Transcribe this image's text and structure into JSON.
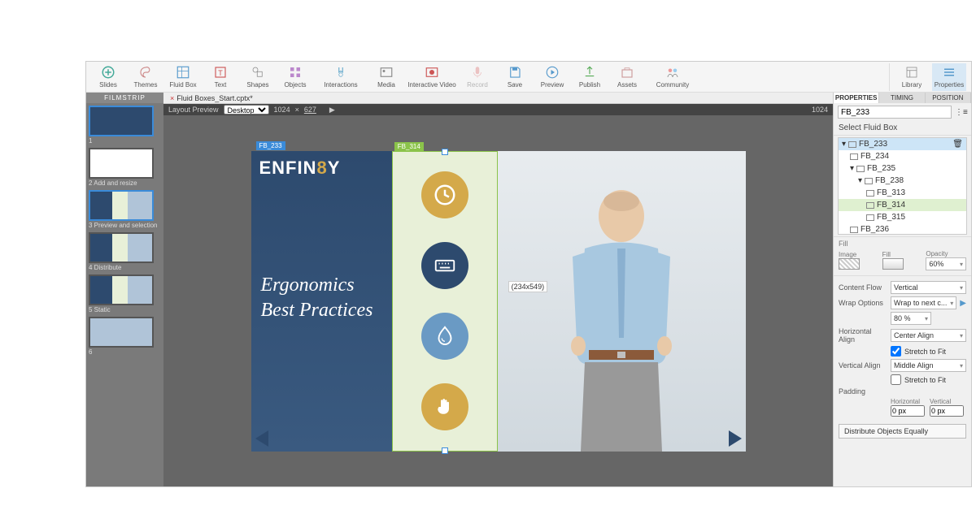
{
  "toolbar": {
    "items": [
      "Slides",
      "Themes",
      "Fluid Box",
      "Text",
      "Shapes",
      "Objects",
      "Interactions",
      "Media",
      "Interactive Video",
      "Record",
      "Save",
      "Preview",
      "Publish",
      "Assets",
      "Community"
    ],
    "right": [
      "Library",
      "Properties"
    ]
  },
  "filmstrip": {
    "header": "FILMSTRIP",
    "thumbs": [
      {
        "cap": "1"
      },
      {
        "cap": "2 Add and resize"
      },
      {
        "cap": "3 Preview and selection"
      },
      {
        "cap": "4 Distribute"
      },
      {
        "cap": "5 Static"
      },
      {
        "cap": "6"
      }
    ]
  },
  "doc": {
    "tab": "Fluid Boxes_Start.cptx*",
    "layoutPreview": "Layout Preview",
    "device": "Desktop",
    "w": "1024",
    "h": "627",
    "rulerMark": "1024"
  },
  "slide": {
    "fb233": "FB_233",
    "fb314": "FB_314",
    "logo_pre": "ENFIN",
    "logo_num": "8",
    "logo_post": "Y",
    "title": "Ergonomics Best Practices",
    "dim": "(234x549)"
  },
  "panel": {
    "tabs": [
      "PROPERTIES",
      "TIMING",
      "POSITION"
    ],
    "searchVal": "FB_233",
    "selectLabel": "Select Fluid Box",
    "tree": [
      {
        "name": "FB_233",
        "lvl": 0,
        "sel": true,
        "exp": true
      },
      {
        "name": "FB_234",
        "lvl": 1
      },
      {
        "name": "FB_235",
        "lvl": 1,
        "exp": true
      },
      {
        "name": "FB_238",
        "lvl": 2,
        "exp": true
      },
      {
        "name": "FB_313",
        "lvl": 3
      },
      {
        "name": "FB_314",
        "lvl": 3,
        "hl": true
      },
      {
        "name": "FB_315",
        "lvl": 3
      },
      {
        "name": "FB_236",
        "lvl": 1
      }
    ],
    "fill": {
      "section": "Fill",
      "imageLbl": "Image",
      "fillLbl": "Fill",
      "opacityLbl": "Opacity",
      "opacityVal": "60%"
    },
    "flow": {
      "label": "Content Flow",
      "value": "Vertical"
    },
    "wrap": {
      "label": "Wrap Options",
      "value": "Wrap to next c...",
      "pct": "80 %"
    },
    "halign": {
      "label": "Horizontal Align",
      "value": "Center Align",
      "stretch": "Stretch to Fit",
      "stretchChecked": true
    },
    "valign": {
      "label": "Vertical Align",
      "value": "Middle Align",
      "stretch": "Stretch to Fit",
      "stretchChecked": false
    },
    "padding": {
      "label": "Padding",
      "hLbl": "Horizontal",
      "vLbl": "Vertical",
      "h": "0 px",
      "v": "0 px"
    },
    "distBtn": "Distribute Objects Equally"
  }
}
